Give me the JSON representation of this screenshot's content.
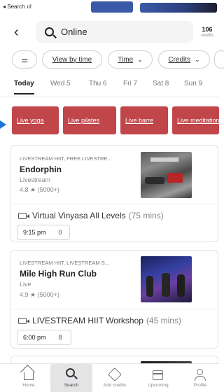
{
  "status_bar": {
    "carrier": "◂ Search",
    "signal": "ııl"
  },
  "search": {
    "query": "Online",
    "credits_count": "106",
    "credits_label": "credits"
  },
  "filters": [
    {
      "label": "View by time"
    },
    {
      "label": "Time"
    },
    {
      "label": "Credits"
    }
  ],
  "days": [
    "Today",
    "Wed 5",
    "Thu 6",
    "Fri 7",
    "Sat 8",
    "Sun 9"
  ],
  "categories": [
    "Live yoga",
    "Live pilates",
    "Live barre",
    "Live meditation"
  ],
  "results": [
    {
      "tags": "LIVESTREAM HIIT, FREE LIVESTRE...",
      "name": "Endorphin",
      "location": "Livestream",
      "rating": "4.8 ★ (5000+)",
      "class_title": "Virtual Vinyasa All Levels",
      "duration": "(75 mins)",
      "time": "9:15 pm",
      "spots": "0"
    },
    {
      "tags": "LIVESTREAM HIIT, LIVESTREAM S...",
      "name": "Mile High Run Club",
      "location": "Live",
      "rating": "4.9 ★ (5000+)",
      "class_title": "LIVESTREAM HIIT Workshop",
      "duration": "(45 mins)",
      "time": "6:00 pm",
      "spots": "8"
    }
  ],
  "tabs": [
    "Home",
    "Search",
    "Add credits",
    "Upcoming",
    "Profile"
  ],
  "colors": {
    "category_chip": "#c0464a",
    "marker_arrow": "#1f73d9"
  }
}
